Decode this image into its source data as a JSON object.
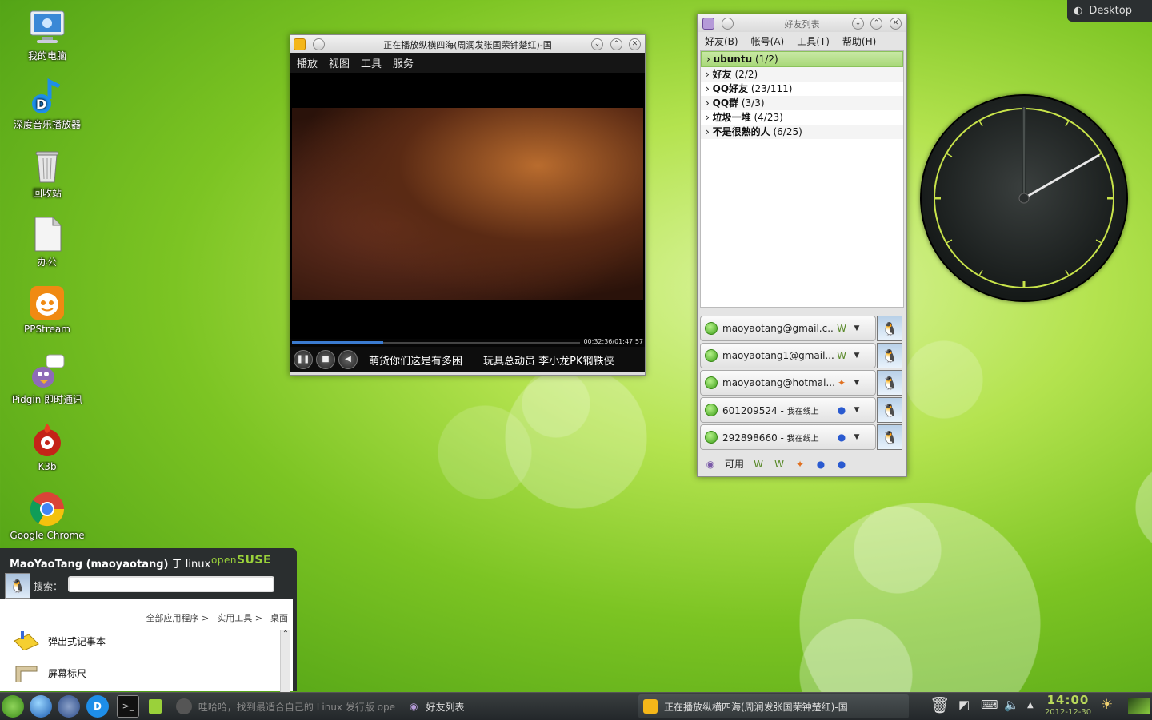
{
  "desktop_button": {
    "label": "Desktop"
  },
  "desktop_icons": [
    {
      "label": "我的电脑"
    },
    {
      "label": "深度音乐播放器"
    },
    {
      "label": "回收站"
    },
    {
      "label": "办公"
    },
    {
      "label": "PPStream"
    },
    {
      "label": "Pidgin 即时通讯"
    },
    {
      "label": "K3b"
    },
    {
      "label": "Google Chrome"
    }
  ],
  "player": {
    "title": "正在播放纵横四海(周润发张国荣钟楚红)-国",
    "menu": [
      "播放",
      "视图",
      "工具",
      "服务"
    ],
    "time": "00:32:36/01:47:57",
    "progress": 0.302,
    "ticker": "萌货你们这是有多困　　玩具总动员 李小龙PK钢铁侠"
  },
  "buddy_list": {
    "title": "好友列表",
    "menu": [
      "好友(B)",
      "帐号(A)",
      "工具(T)",
      "帮助(H)"
    ],
    "groups": [
      {
        "name": "ubuntu",
        "count": "(1/2)"
      },
      {
        "name": "好友",
        "count": "(2/2)"
      },
      {
        "name": "QQ好友",
        "count": "(23/111)"
      },
      {
        "name": "QQ群",
        "count": "(3/3)"
      },
      {
        "name": "垃圾一堆",
        "count": "(4/23)"
      },
      {
        "name": "不是很熟的人",
        "count": "(6/25)"
      }
    ],
    "accounts": [
      {
        "name": "maoyaotang@gmail.c...",
        "status": ""
      },
      {
        "name": "maoyaotang1@gmail....",
        "status": ""
      },
      {
        "name": "maoyaotang@hotmai...",
        "status": ""
      },
      {
        "name": "601209524 - ",
        "status": "我在线上"
      },
      {
        "name": "292898660 - ",
        "status": "我在线上"
      }
    ],
    "status_label": "可用"
  },
  "kickoff": {
    "user": "MaoYaoTang (maoyaotang)",
    "host": " 于 linux-m",
    "brand_prefix": "open",
    "brand": "SUSE",
    "search_label": "搜索：",
    "search_value": "",
    "breadcrumbs": [
      "全部应用程序 >",
      "实用工具 >",
      "桌面"
    ],
    "items": [
      "弹出式记事本",
      "屏幕标尺"
    ]
  },
  "taskbar": {
    "tasks": [
      {
        "label": "哇哈哈，找到最适合自己的 Linux 发行版 ope"
      },
      {
        "label": "好友列表"
      },
      {
        "label": "正在播放纵横四海(周润发张国荣钟楚红)-国"
      }
    ],
    "time": "14:00",
    "date": "2012-12-30"
  },
  "colors": {
    "accent": "#9ad13a",
    "panel": "#2a2e2f",
    "clock_ring": "#c8e34a"
  }
}
